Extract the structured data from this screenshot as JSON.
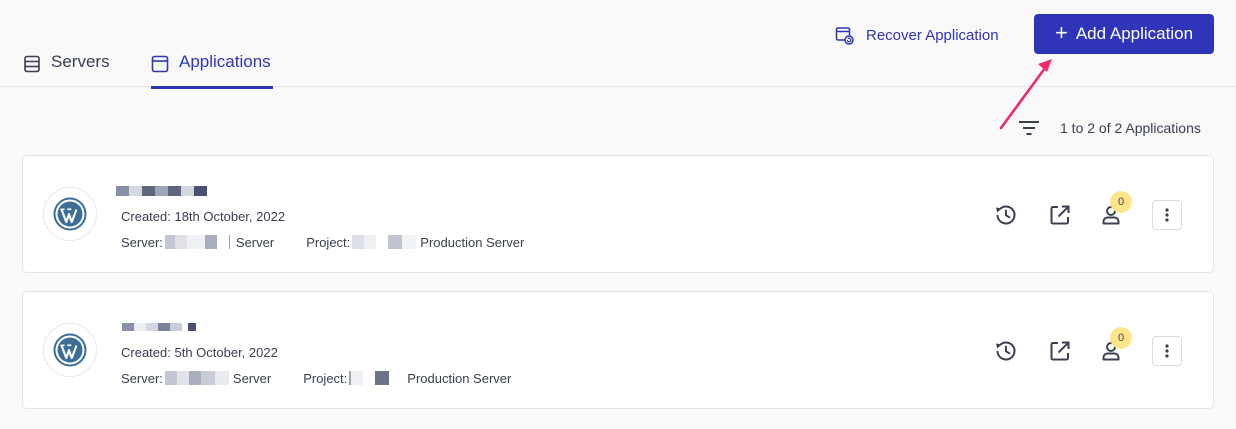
{
  "header": {
    "tabs": [
      {
        "label": "Servers",
        "icon": "server-icon",
        "active": false
      },
      {
        "label": "Applications",
        "icon": "window-icon",
        "active": true
      }
    ],
    "recover_label": "Recover Application",
    "add_label": "Add Application"
  },
  "list": {
    "count_text": "1 to 2 of 2 Applications"
  },
  "applications": [
    {
      "created": "Created: 18th October, 2022",
      "server_label": "Server:",
      "server_suffix": "Server",
      "project_label": "Project:",
      "project_suffix": "Production Server",
      "collaborators": "0"
    },
    {
      "created": "Created: 5th October, 2022",
      "server_label": "Server:",
      "server_suffix": "Server",
      "project_label": "Project:",
      "project_suffix": "Production Server",
      "collaborators": "0"
    }
  ],
  "colors": {
    "accent": "#2e35b8",
    "badge": "#fde68a",
    "annotation_arrow": "#ee2a6b",
    "wordpress": "#3d6e98"
  }
}
